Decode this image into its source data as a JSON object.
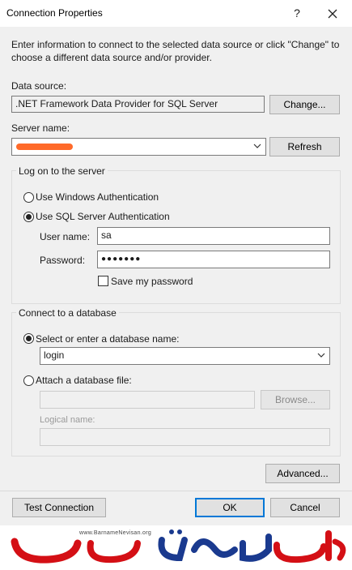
{
  "window": {
    "title": "Connection Properties",
    "help_glyph": "?"
  },
  "intro": "Enter information to connect to the selected data source or click \"Change\" to choose a different data source and/or provider.",
  "data_source": {
    "label": "Data source:",
    "value": ".NET Framework Data Provider for SQL Server",
    "change_button": "Change..."
  },
  "server": {
    "label": "Server name:",
    "refresh_button": "Refresh"
  },
  "logon": {
    "group_title": "Log on to the server",
    "windows_auth": "Use Windows Authentication",
    "sql_auth": "Use SQL Server Authentication",
    "selected": "sql_auth",
    "username_label": "User name:",
    "username_value": "sa",
    "password_label": "Password:",
    "password_mask": "●●●●●●●",
    "save_password_label": "Save my password",
    "save_password_checked": false
  },
  "database": {
    "group_title": "Connect to a database",
    "select_option": "Select or enter a database name:",
    "selected": "select_option",
    "database_value": "login",
    "attach_option": "Attach a database file:",
    "browse_button": "Browse...",
    "logical_name_label": "Logical name:"
  },
  "buttons": {
    "advanced": "Advanced...",
    "test_connection": "Test Connection",
    "ok": "OK",
    "cancel": "Cancel"
  },
  "watermark": {
    "url": "www.BarnameNevisan.org",
    "accent_colors": [
      "#d40f15",
      "#1a3a8f"
    ]
  }
}
